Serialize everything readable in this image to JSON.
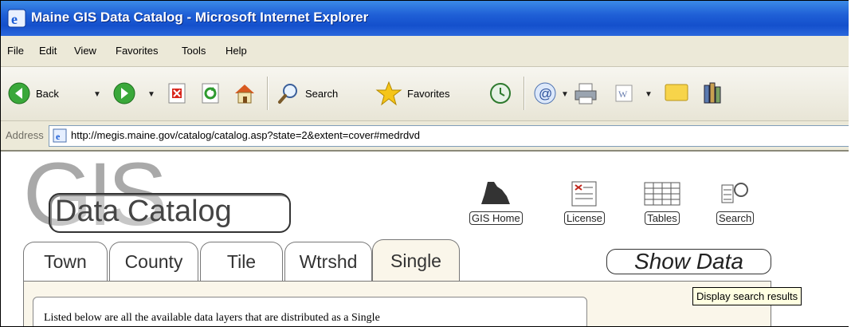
{
  "window": {
    "title": "Maine GIS Data Catalog - Microsoft Internet Explorer"
  },
  "menubar": {
    "items": [
      "File",
      "Edit",
      "View",
      "Favorites",
      "Tools",
      "Help"
    ]
  },
  "toolbar": {
    "back_label": "Back",
    "search_label": "Search",
    "favorites_label": "Favorites"
  },
  "address": {
    "label": "Address",
    "url": "http://megis.maine.gov/catalog/catalog.asp?state=2&extent=cover#medrdvd"
  },
  "page": {
    "logo_big": "GIS",
    "logo_sub": "Data Catalog",
    "nav": {
      "gis_home": "GIS Home",
      "license": "License",
      "tables": "Tables",
      "search": "Search"
    },
    "tabs": [
      "Town",
      "County",
      "Tile",
      "Wtrshd",
      "Single"
    ],
    "active_tab": "Single",
    "show_data_label": "Show Data",
    "tooltip": "Display search results",
    "body_text": "Listed below are all the available data layers that are distributed as a Single"
  },
  "colors": {
    "titlebar": "#1f5fd6",
    "chrome": "#ece9d8",
    "panel": "#faf6ea"
  }
}
